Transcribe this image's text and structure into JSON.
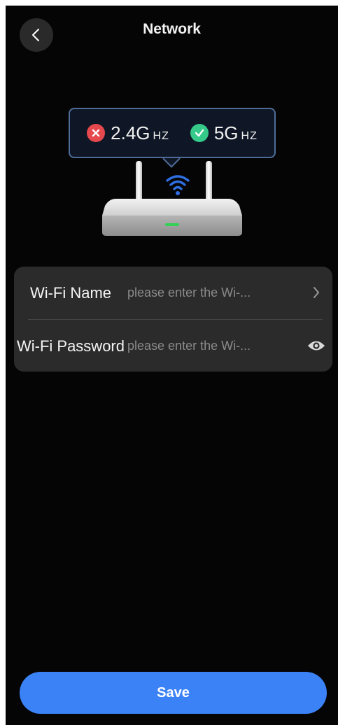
{
  "header": {
    "title": "Network",
    "back_icon": "chevron-left-icon"
  },
  "router": {
    "bands": [
      {
        "number": "2.4G",
        "unit": "HZ",
        "status": "unavailable",
        "icon": "close-circle-icon",
        "color": "#e5484d"
      },
      {
        "number": "5G",
        "unit": "HZ",
        "status": "available",
        "icon": "check-circle-icon",
        "color": "#35c98a"
      }
    ],
    "wifi_icon_color": "#2f6fe4",
    "led_color": "#34d058"
  },
  "form": {
    "wifi_name": {
      "label": "Wi-Fi Name",
      "placeholder": "please enter the Wi-...",
      "icon": "chevron-right-icon"
    },
    "wifi_password": {
      "label": "Wi-Fi Password",
      "placeholder": "please enter the Wi-...",
      "icon": "eye-icon"
    }
  },
  "save_label": "Save",
  "colors": {
    "accent": "#3b82f6",
    "background": "#050505",
    "card": "#2b2b2b"
  }
}
